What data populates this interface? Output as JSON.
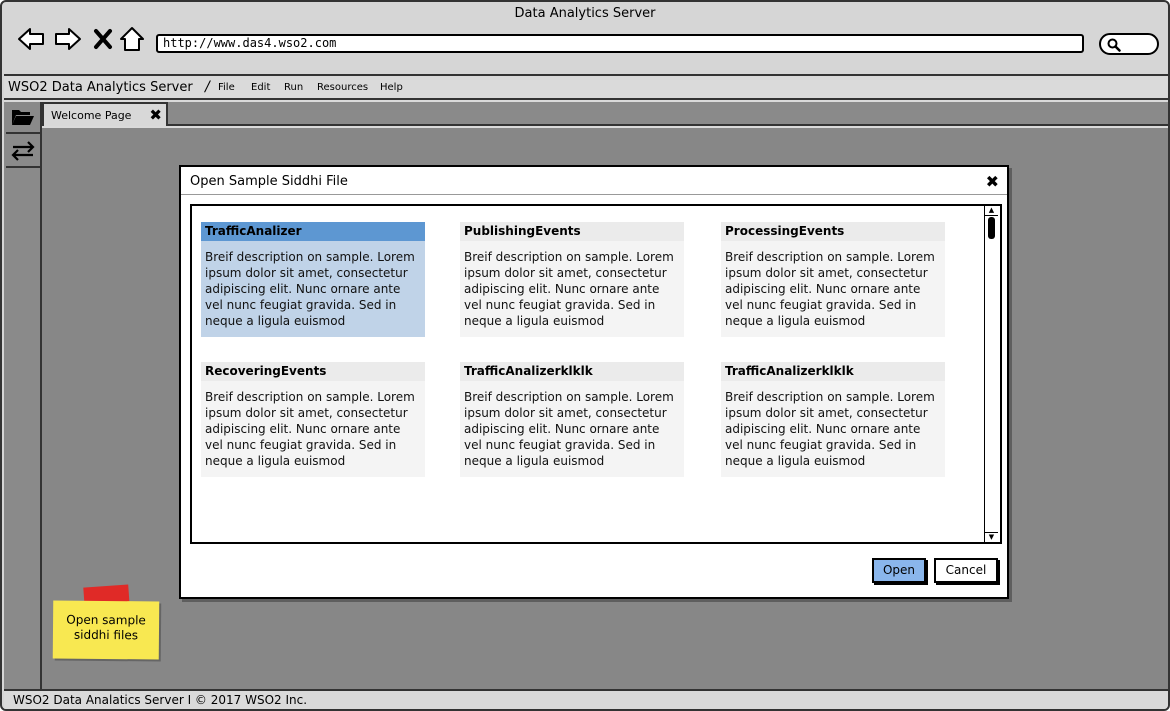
{
  "browser": {
    "title": "Data Analytics Server",
    "url": "http://www.das4.wso2.com",
    "icons": [
      "back-arrow-icon",
      "forward-arrow-icon",
      "stop-icon",
      "home-icon",
      "search-icon"
    ]
  },
  "app": {
    "name": "WSO2 Data Analytics Server",
    "menu_separator": "/",
    "menu": [
      "File",
      "Edit",
      "Run",
      "Resources",
      "Help"
    ],
    "rail_icons": [
      "folder-open-icon",
      "transfer-arrows-icon"
    ],
    "tab": {
      "label": "Welcome Page",
      "close": "✖"
    },
    "status": "WSO2 Data Analatics Server I © 2017 WSO2 Inc."
  },
  "dialog": {
    "title": "Open Sample Siddhi File",
    "close": "✖",
    "samples": [
      {
        "title": "TrafficAnalizer",
        "description": "Breif description on sample. Lorem ipsum dolor sit amet, consectetur adipiscing elit. Nunc ornare ante vel nunc feugiat gravida. Sed in neque a ligula euismod"
      },
      {
        "title": "PublishingEvents",
        "description": "Breif description on sample. Lorem ipsum dolor sit amet, consectetur adipiscing elit. Nunc ornare ante vel nunc feugiat gravida. Sed in neque a ligula euismod"
      },
      {
        "title": "ProcessingEvents",
        "description": "Breif description on sample. Lorem ipsum dolor sit amet, consectetur adipiscing elit. Nunc ornare ante vel nunc feugiat gravida. Sed in neque a ligula euismod"
      },
      {
        "title": "RecoveringEvents",
        "description": "Breif description on sample. Lorem ipsum dolor sit amet, consectetur adipiscing elit. Nunc ornare ante vel nunc feugiat gravida. Sed in neque a ligula euismod"
      },
      {
        "title": "TrafficAnalizerklklk",
        "description": "Breif description on sample. Lorem ipsum dolor sit amet, consectetur adipiscing elit. Nunc ornare ante vel nunc feugiat gravida. Sed in neque a ligula euismod"
      },
      {
        "title": "TrafficAnalizerklklk",
        "description": "Breif description on sample. Lorem ipsum dolor sit amet, consectetur adipiscing elit. Nunc ornare ante vel nunc feugiat gravida. Sed in neque a ligula euismod"
      }
    ],
    "open_label": "Open",
    "cancel_label": "Cancel"
  },
  "note": {
    "line1": "Open sample",
    "line2": "siddhi files"
  },
  "colors": {
    "selected_header": "#5d97d2",
    "selected_body": "#c0d3e8",
    "open_button": "#8ab6ec",
    "sticky_note": "#f8e851",
    "sticky_tape": "#e02a27",
    "workspace": "#878787"
  }
}
